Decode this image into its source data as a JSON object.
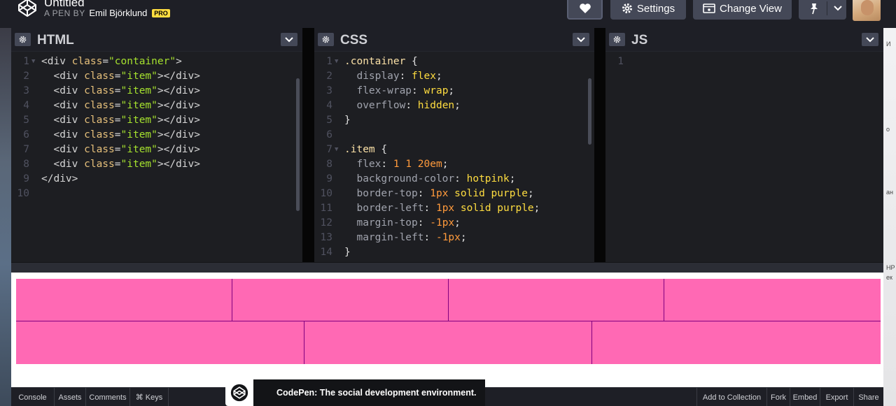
{
  "header": {
    "pen_title": "Untitled",
    "byline_prefix": "A PEN BY",
    "author": "Emil Björklund",
    "badge": "PRO",
    "buttons": {
      "settings": "Settings",
      "change_view": "Change View"
    },
    "icons": [
      "codepen-logo-icon",
      "heart-icon",
      "gear-icon",
      "change-view-icon",
      "pin-icon",
      "chevron-down-icon",
      "avatar"
    ]
  },
  "editors": {
    "html": {
      "title": "HTML",
      "lines": [
        {
          "n": "1",
          "fold": true,
          "tokens": [
            [
              "tg",
              "<div "
            ],
            [
              "at",
              "class"
            ],
            [
              "tg",
              "="
            ],
            [
              "sv",
              "\"container\""
            ],
            [
              "tg",
              ">"
            ]
          ]
        },
        {
          "n": "2",
          "fold": false,
          "tokens": [
            [
              "tg",
              "  <div "
            ],
            [
              "at",
              "class"
            ],
            [
              "tg",
              "="
            ],
            [
              "sv",
              "\"item\""
            ],
            [
              "tg",
              "></div>"
            ]
          ]
        },
        {
          "n": "3",
          "fold": false,
          "tokens": [
            [
              "tg",
              "  <div "
            ],
            [
              "at",
              "class"
            ],
            [
              "tg",
              "="
            ],
            [
              "sv",
              "\"item\""
            ],
            [
              "tg",
              "></div>"
            ]
          ]
        },
        {
          "n": "4",
          "fold": false,
          "tokens": [
            [
              "tg",
              "  <div "
            ],
            [
              "at",
              "class"
            ],
            [
              "tg",
              "="
            ],
            [
              "sv",
              "\"item\""
            ],
            [
              "tg",
              "></div>"
            ]
          ]
        },
        {
          "n": "5",
          "fold": false,
          "tokens": [
            [
              "tg",
              "  <div "
            ],
            [
              "at",
              "class"
            ],
            [
              "tg",
              "="
            ],
            [
              "sv",
              "\"item\""
            ],
            [
              "tg",
              "></div>"
            ]
          ]
        },
        {
          "n": "6",
          "fold": false,
          "tokens": [
            [
              "tg",
              "  <div "
            ],
            [
              "at",
              "class"
            ],
            [
              "tg",
              "="
            ],
            [
              "sv",
              "\"item\""
            ],
            [
              "tg",
              "></div>"
            ]
          ]
        },
        {
          "n": "7",
          "fold": false,
          "tokens": [
            [
              "tg",
              "  <div "
            ],
            [
              "at",
              "class"
            ],
            [
              "tg",
              "="
            ],
            [
              "sv",
              "\"item\""
            ],
            [
              "tg",
              "></div>"
            ]
          ]
        },
        {
          "n": "8",
          "fold": false,
          "tokens": [
            [
              "tg",
              "  <div "
            ],
            [
              "at",
              "class"
            ],
            [
              "tg",
              "="
            ],
            [
              "sv",
              "\"item\""
            ],
            [
              "tg",
              "></div>"
            ]
          ]
        },
        {
          "n": "9",
          "fold": false,
          "tokens": [
            [
              "tg",
              "</div>"
            ]
          ]
        },
        {
          "n": "10",
          "fold": false,
          "tokens": []
        }
      ]
    },
    "css": {
      "title": "CSS",
      "lines": [
        {
          "n": "1",
          "fold": true,
          "tokens": [
            [
              "sel",
              ".container"
            ],
            [
              "pn",
              " {"
            ]
          ]
        },
        {
          "n": "2",
          "fold": false,
          "tokens": [
            [
              "pr",
              "  display"
            ],
            [
              "pn",
              ": "
            ],
            [
              "vl",
              "flex"
            ],
            [
              "pn",
              ";"
            ]
          ]
        },
        {
          "n": "3",
          "fold": false,
          "tokens": [
            [
              "pr",
              "  flex-wrap"
            ],
            [
              "pn",
              ": "
            ],
            [
              "vl",
              "wrap"
            ],
            [
              "pn",
              ";"
            ]
          ]
        },
        {
          "n": "4",
          "fold": false,
          "tokens": [
            [
              "pr",
              "  overflow"
            ],
            [
              "pn",
              ": "
            ],
            [
              "vl",
              "hidden"
            ],
            [
              "pn",
              ";"
            ]
          ]
        },
        {
          "n": "5",
          "fold": false,
          "tokens": [
            [
              "pn",
              "}"
            ]
          ]
        },
        {
          "n": "6",
          "fold": false,
          "tokens": []
        },
        {
          "n": "7",
          "fold": true,
          "tokens": [
            [
              "sel",
              ".item"
            ],
            [
              "pn",
              " {"
            ]
          ]
        },
        {
          "n": "8",
          "fold": false,
          "tokens": [
            [
              "pr",
              "  flex"
            ],
            [
              "pn",
              ": "
            ],
            [
              "nm",
              "1 1 20em"
            ],
            [
              "pn",
              ";"
            ]
          ]
        },
        {
          "n": "9",
          "fold": false,
          "tokens": [
            [
              "pr",
              "  background-color"
            ],
            [
              "pn",
              ": "
            ],
            [
              "vl",
              "hotpink"
            ],
            [
              "pn",
              ";"
            ]
          ]
        },
        {
          "n": "10",
          "fold": false,
          "tokens": [
            [
              "pr",
              "  border-top"
            ],
            [
              "pn",
              ": "
            ],
            [
              "nm",
              "1px"
            ],
            [
              "vl",
              " solid purple"
            ],
            [
              "pn",
              ";"
            ]
          ]
        },
        {
          "n": "11",
          "fold": false,
          "tokens": [
            [
              "pr",
              "  border-left"
            ],
            [
              "pn",
              ": "
            ],
            [
              "nm",
              "1px"
            ],
            [
              "vl",
              " solid purple"
            ],
            [
              "pn",
              ";"
            ]
          ]
        },
        {
          "n": "12",
          "fold": false,
          "tokens": [
            [
              "pr",
              "  margin-top"
            ],
            [
              "pn",
              ": "
            ],
            [
              "nm",
              "-1px"
            ],
            [
              "pn",
              ";"
            ]
          ]
        },
        {
          "n": "13",
          "fold": false,
          "tokens": [
            [
              "pr",
              "  margin-left"
            ],
            [
              "pn",
              ": "
            ],
            [
              "nm",
              "-1px"
            ],
            [
              "pn",
              ";"
            ]
          ]
        },
        {
          "n": "14",
          "fold": false,
          "tokens": [
            [
              "pn",
              "}"
            ]
          ]
        }
      ]
    },
    "js": {
      "title": "JS",
      "lines": [
        {
          "n": "1",
          "fold": false,
          "tokens": []
        }
      ]
    }
  },
  "preview": {
    "item_color": "#ff69b4",
    "border_color": "#800080",
    "rows": [
      4,
      3
    ]
  },
  "footer": {
    "left": [
      "Console",
      "Assets",
      "Comments",
      "⌘ Keys"
    ],
    "right": [
      "Add to Collection",
      "Fork",
      "Embed",
      "Export",
      "Share"
    ],
    "toast": "CodePen: The social development environment."
  },
  "side_fragments": [
    "И",
    "о",
    "ан",
    "НР",
    "ек"
  ]
}
